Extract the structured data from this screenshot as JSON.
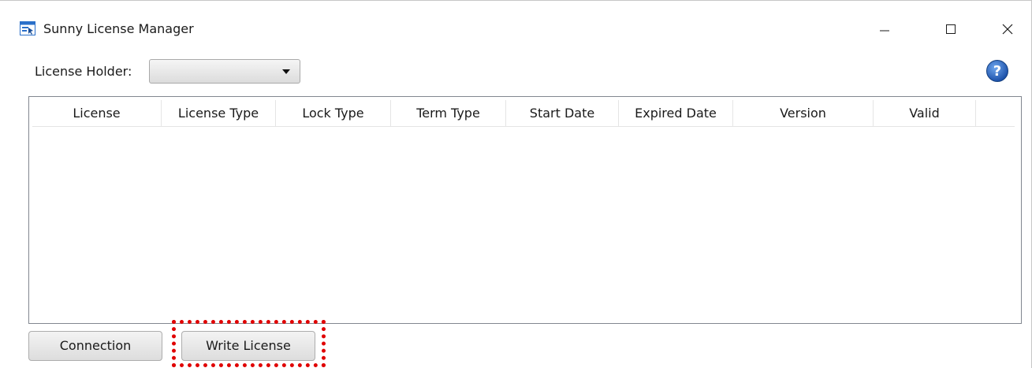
{
  "window": {
    "title": "Sunny License Manager",
    "icon": "app-window-icon"
  },
  "controls": {
    "minimize": "minimize-icon",
    "maximize": "maximize-icon",
    "close": "close-icon"
  },
  "holder": {
    "label": "License Holder:",
    "selected_value": ""
  },
  "help": {
    "icon": "help-icon",
    "color": "#1f5fb4"
  },
  "table": {
    "columns": [
      "License",
      "License Type",
      "Lock Type",
      "Term Type",
      "Start Date",
      "Expired Date",
      "Version",
      "Valid"
    ],
    "rows": []
  },
  "buttons": {
    "connection": "Connection",
    "write_license": "Write License"
  },
  "annotation": {
    "highlight_color": "#e00000",
    "highlighted_element": "write-license-button"
  }
}
